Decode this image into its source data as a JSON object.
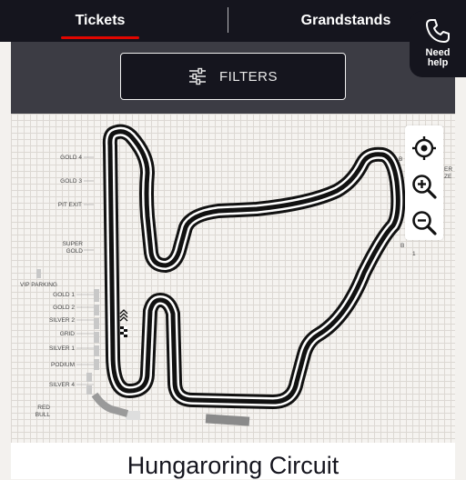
{
  "tabs": [
    {
      "label": "Tickets",
      "active": true
    },
    {
      "label": "Grandstands",
      "active": false
    }
  ],
  "help": {
    "label": "Need help",
    "icon": "phone-icon"
  },
  "filters": {
    "label": "FILTERS",
    "icon": "sliders-icon"
  },
  "map_controls": [
    {
      "name": "recenter-icon"
    },
    {
      "name": "zoom-in-icon"
    },
    {
      "name": "zoom-out-icon"
    }
  ],
  "map_labels": {
    "gold4": "GOLD 4",
    "gold3": "GOLD 3",
    "pitexit": "PIT EXIT",
    "supergold1": "SUPER",
    "supergold2": "GOLD",
    "vip": "VIP PARKING",
    "gold1": "GOLD 1",
    "gold2": "GOLD 2",
    "silver2": "SILVER 2",
    "grid": "GRID",
    "silver1": "SILVER 1",
    "podium": "PODIUM",
    "silver4": "SILVER 4",
    "redbull1": "RED",
    "redbull2": "BULL",
    "right1": "B",
    "right2": "ER",
    "right3": "ZE",
    "right4": "B",
    "right5": "1"
  },
  "circuit_title": "Hungaroring Circuit",
  "colors": {
    "accent": "#e10600",
    "dark": "#15151e",
    "track": "#111111"
  }
}
